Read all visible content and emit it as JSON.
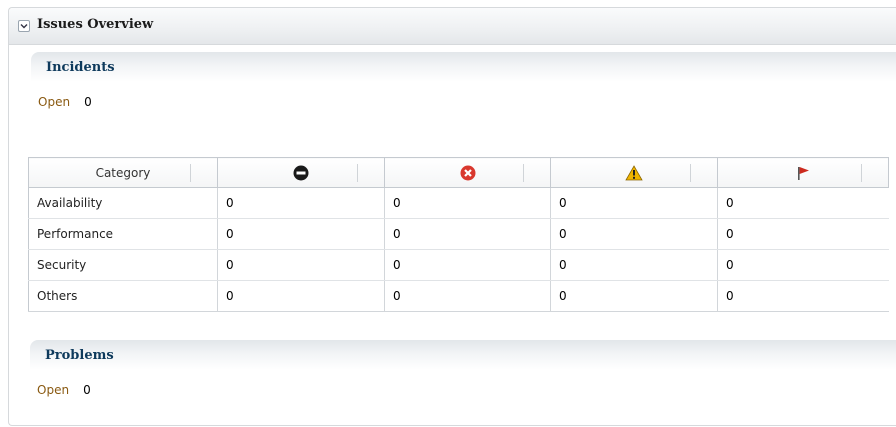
{
  "panel": {
    "title": "Issues Overview",
    "collapse_icon": "chevron-down-icon"
  },
  "incidents": {
    "title": "Incidents",
    "open_label": "Open",
    "open_value": "0",
    "table": {
      "category_header": "Category",
      "severity_columns": [
        {
          "icon": "fatal-icon",
          "color": "#1a1a1a"
        },
        {
          "icon": "critical-icon",
          "color": "#d9382e"
        },
        {
          "icon": "warning-icon",
          "color": "#f0b400"
        },
        {
          "icon": "advisory-flag-icon",
          "color": "#cc2a1e"
        }
      ],
      "rows": [
        {
          "category": "Availability",
          "values": [
            "0",
            "0",
            "0",
            "0"
          ]
        },
        {
          "category": "Performance",
          "values": [
            "0",
            "0",
            "0",
            "0"
          ]
        },
        {
          "category": "Security",
          "values": [
            "0",
            "0",
            "0",
            "0"
          ]
        },
        {
          "category": "Others",
          "values": [
            "0",
            "0",
            "0",
            "0"
          ]
        }
      ]
    }
  },
  "problems": {
    "title": "Problems",
    "open_label": "Open",
    "open_value": "0"
  }
}
